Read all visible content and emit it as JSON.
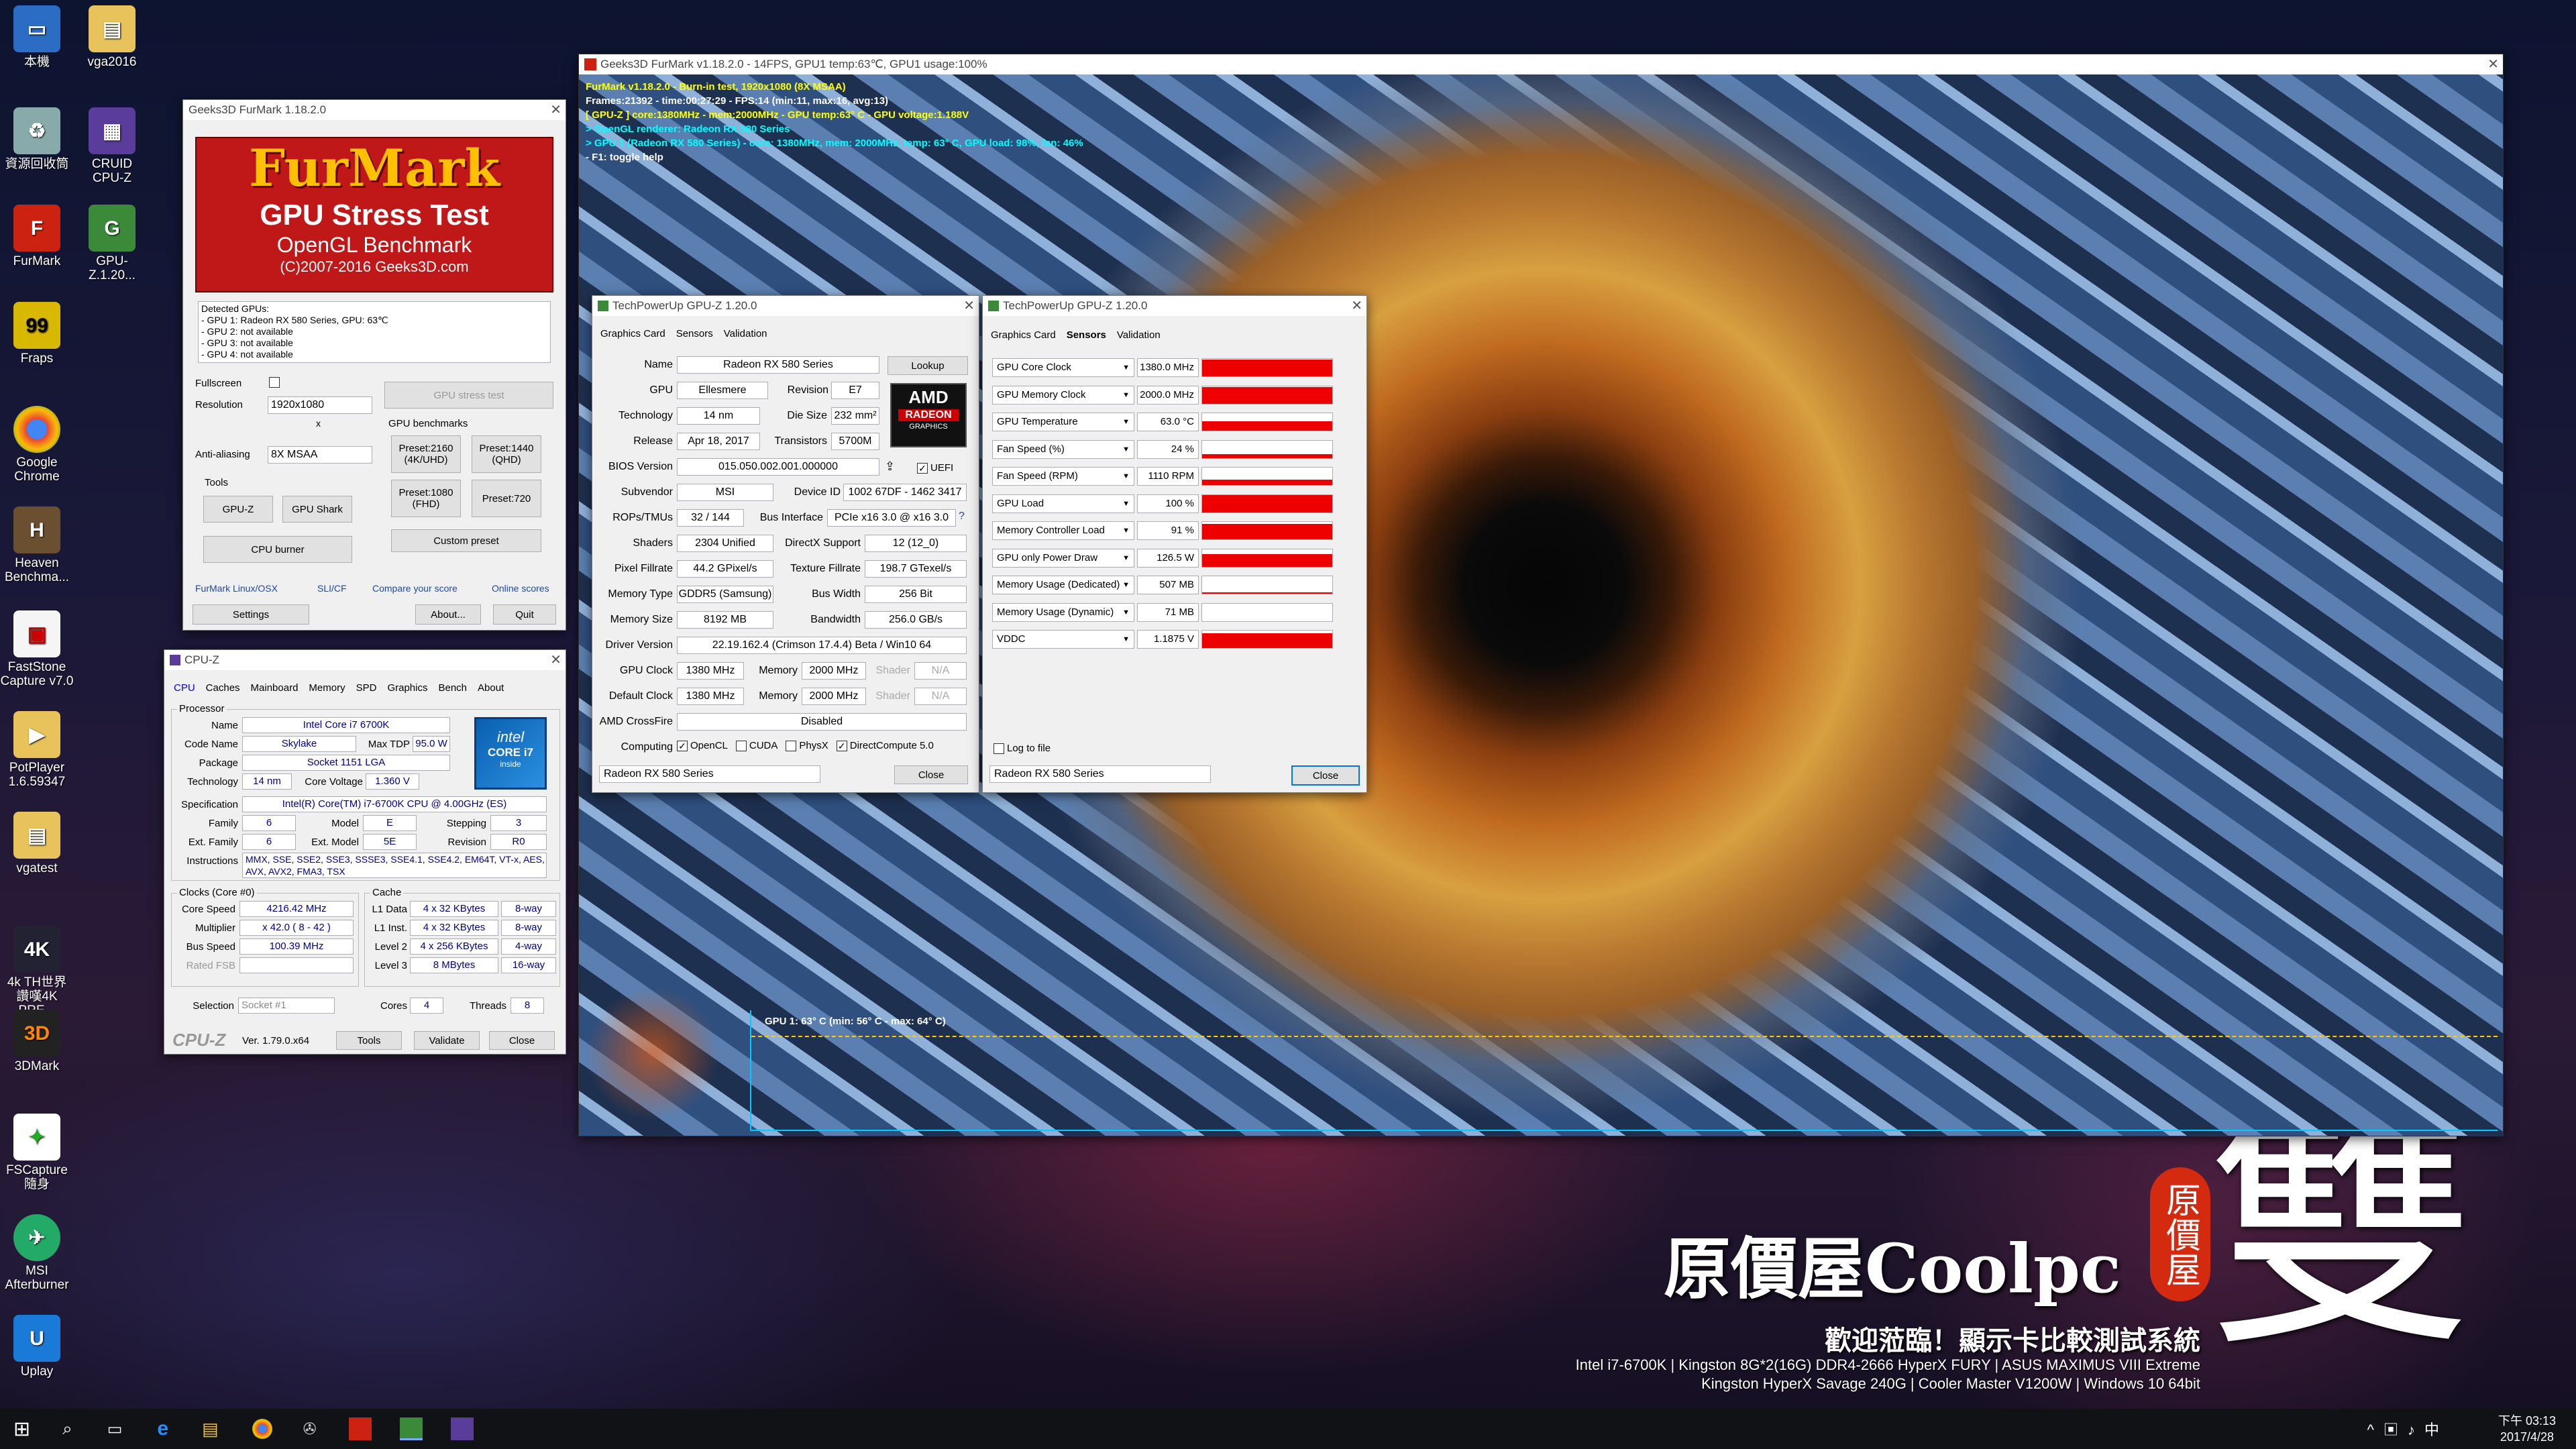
{
  "desktop": {
    "icons": [
      "本機",
      "vga2016",
      "資源回收筒",
      "CRUID CPU-Z",
      "FurMark",
      "GPU-Z.1.20...",
      "Fraps",
      "Google Chrome",
      "Heaven Benchma...",
      "FastStone Capture v7.0",
      "PotPlayer 1.6.59347",
      "vgatest",
      "4k TH世界\n讚嘆4K PRE...",
      "3DMark",
      "FSCapture\n隨身",
      "MSI Afterburner",
      "Uplay"
    ],
    "watermark": {
      "brand": "原價屋Coolpc",
      "seal": "原價屋",
      "char": "雙",
      "welcome": "歡迎蒞臨！顯示卡比較測試系統",
      "spec1": "Intel i7-6700K | Kingston 8G*2(16G) DDR4-2666 HyperX FURY | ASUS MAXIMUS VIII Extreme",
      "spec2": "Kingston HyperX Savage 240G | Cooler Master V1200W | Windows 10 64bit"
    }
  },
  "furmark_main": {
    "title": "Geeks3D FurMark v1.18.2.0 - 14FPS, GPU1 temp:63℃, GPU1 usage:100%",
    "lines": [
      "FurMark v1.18.2.0 - Burn-in test, 1920x1080 (8X MSAA)",
      "Frames:21392 - time:00:27:29 - FPS:14 (min:11, max:16, avg:13)",
      "[ GPU-Z ] core:1380MHz - mem:2000MHz - GPU temp:63° C - GPU voltage:1.188V",
      "> OpenGL renderer: Radeon RX 580 Series",
      "> GPU 1 (Radeon RX 580 Series) - core: 1380MHz, mem: 2000MHz, temp: 63° C, GPU load: 98%, fan: 46%",
      "- F1: toggle help"
    ],
    "graph_label": "GPU 1: 63° C (min: 56° C - max: 64° C)"
  },
  "furmark_launcher": {
    "title": "Geeks3D FurMark 1.18.2.0",
    "logo": "FurMark",
    "logo_sub1": "GPU Stress Test",
    "logo_sub2": "OpenGL Benchmark",
    "logo_sub3": "(C)2007-2016 Geeks3D.com",
    "detected": [
      "Detected GPUs:",
      "- GPU 1: Radeon RX 580 Series, GPU: 63℃",
      "- GPU 2: not available",
      "- GPU 3: not available",
      "- GPU 4: not available"
    ],
    "fullscreen": "Fullscreen",
    "resolution_label": "Resolution",
    "resolution": "1920x1080",
    "x": "x",
    "aa_label": "Anti-aliasing",
    "aa": "8X MSAA",
    "stress_btn": "GPU stress test",
    "bench_label": "GPU benchmarks",
    "tools_label": "Tools",
    "btns": {
      "gpuz": "GPU-Z",
      "shark": "GPU Shark",
      "burner": "CPU burner",
      "p2160": "Preset:2160\n(4K/UHD)",
      "p1440": "Preset:1440\n(QHD)",
      "p1080": "Preset:1080\n(FHD)",
      "p720": "Preset:720",
      "custom": "Custom preset",
      "settings": "Settings",
      "about": "About...",
      "quit": "Quit"
    },
    "links": [
      "FurMark Linux/OSX",
      "SLI/CF",
      "Compare your score",
      "Online scores"
    ]
  },
  "cpuz": {
    "title": "CPU-Z",
    "tabs": [
      "CPU",
      "Caches",
      "Mainboard",
      "Memory",
      "SPD",
      "Graphics",
      "Bench",
      "About"
    ],
    "processor": "Processor",
    "name": "Intel Core i7 6700K",
    "codename": "Skylake",
    "tdp": "95.0 W",
    "package": "Socket 1151 LGA",
    "tech": "14 nm",
    "voltage": "1.360 V",
    "spec": "Intel(R) Core(TM) i7-6700K CPU @ 4.00GHz (ES)",
    "family": "6",
    "model": "E",
    "stepping": "3",
    "extfamily": "6",
    "extmodel": "5E",
    "revision": "R0",
    "instr": "MMX, SSE, SSE2, SSE3, SSSE3, SSE4.1, SSE4.2, EM64T, VT-x, AES, AVX, AVX2, FMA3, TSX",
    "clocks": "Clocks (Core #0)",
    "cache": "Cache",
    "corespeed": "4216.42 MHz",
    "mult": "x 42.0 ( 8 - 42 )",
    "bus": "100.39 MHz",
    "ratedfsb": "Rated FSB",
    "l1d": "4 x 32 KBytes",
    "l1dw": "8-way",
    "l1i": "4 x 32 KBytes",
    "l1iw": "8-way",
    "l2": "4 x 256 KBytes",
    "l2w": "4-way",
    "l3": "8 MBytes",
    "l3w": "16-way",
    "selection": "Socket #1",
    "cores": "4",
    "threads": "8",
    "brand": "CPU-Z",
    "ver": "Ver. 1.79.0.x64",
    "tools": "Tools",
    "validate": "Validate",
    "close": "Close",
    "labels": {
      "name": "Name",
      "codename": "Code Name",
      "tdp": "Max TDP",
      "package": "Package",
      "tech": "Technology",
      "voltage": "Core Voltage",
      "spec": "Specification",
      "family": "Family",
      "model": "Model",
      "stepping": "Stepping",
      "extfamily": "Ext. Family",
      "extmodel": "Ext. Model",
      "revision": "Revision",
      "instr": "Instructions",
      "corespeed": "Core Speed",
      "mult": "Multiplier",
      "bus": "Bus Speed",
      "l1d": "L1 Data",
      "l1i": "L1 Inst.",
      "l2": "Level 2",
      "l3": "Level 3",
      "selection": "Selection",
      "cores": "Cores",
      "threads": "Threads"
    },
    "intel": "intel",
    "core": "CORE i7",
    "inside": "inside"
  },
  "gpuz1": {
    "title": "TechPowerUp GPU-Z 1.20.0",
    "tabs": [
      "Graphics Card",
      "Sensors",
      "Validation"
    ],
    "labels": {
      "name": "Name",
      "gpu": "GPU",
      "revision": "Revision",
      "tech": "Technology",
      "die": "Die Size",
      "release": "Release",
      "trans": "Transistors",
      "bios": "BIOS Version",
      "subvendor": "Subvendor",
      "devid": "Device ID",
      "rops": "ROPs/TMUs",
      "busif": "Bus Interface",
      "shaders": "Shaders",
      "dx": "DirectX Support",
      "pixel": "Pixel Fillrate",
      "texture": "Texture Fillrate",
      "memtype": "Memory Type",
      "buswidth": "Bus Width",
      "memsize": "Memory Size",
      "bandwidth": "Bandwidth",
      "driver": "Driver Version",
      "gpuclock": "GPU Clock",
      "memory": "Memory",
      "shader": "Shader",
      "defclock": "Default Clock",
      "crossfire": "AMD CrossFire",
      "computing": "Computing"
    },
    "name": "Radeon RX 580 Series",
    "lookup": "Lookup",
    "gpu": "Ellesmere",
    "revision": "E7",
    "tech": "14 nm",
    "die": "232 mm²",
    "release": "Apr 18, 2017",
    "trans": "5700M",
    "bios": "015.050.002.001.000000",
    "uefi": "UEFI",
    "subvendor": "MSI",
    "devid": "1002 67DF - 1462 3417",
    "rops": "32 / 144",
    "busif": "PCIe x16 3.0 @ x16 3.0",
    "shaders": "2304 Unified",
    "dx": "12 (12_0)",
    "pixel": "44.2 GPixel/s",
    "texture": "198.7 GTexel/s",
    "memtype": "GDDR5 (Samsung)",
    "buswidth": "256 Bit",
    "memsize": "8192 MB",
    "bandwidth": "256.0 GB/s",
    "driver": "22.19.162.4 (Crimson 17.4.4) Beta / Win10 64",
    "gpuclock": "1380 MHz",
    "memclock": "2000 MHz",
    "shaderclock": "N/A",
    "defclock": "1380 MHz",
    "defmem": "2000 MHz",
    "defshader": "N/A",
    "crossfire": "Disabled",
    "compute": [
      "OpenCL",
      "CUDA",
      "PhysX",
      "DirectCompute 5.0"
    ],
    "select": "Radeon RX 580 Series",
    "close": "Close",
    "amd": "AMD",
    "radeon": "RADEON",
    "graphics": "GRAPHICS"
  },
  "gpuz2": {
    "title": "TechPowerUp GPU-Z 1.20.0",
    "tabs": [
      "Graphics Card",
      "Sensors",
      "Validation"
    ],
    "sensors": [
      {
        "name": "GPU Core Clock",
        "value": "1380.0 MHz",
        "fill": 0.95
      },
      {
        "name": "GPU Memory Clock",
        "value": "2000.0 MHz",
        "fill": 0.95
      },
      {
        "name": "GPU Temperature",
        "value": "63.0 °C",
        "fill": 0.55
      },
      {
        "name": "Fan Speed (%)",
        "value": "24 %",
        "fill": 0.2
      },
      {
        "name": "Fan Speed (RPM)",
        "value": "1110 RPM",
        "fill": 0.3
      },
      {
        "name": "GPU Load",
        "value": "100 %",
        "fill": 1.0
      },
      {
        "name": "Memory Controller Load",
        "value": "91 %",
        "fill": 0.9
      },
      {
        "name": "GPU only Power Draw",
        "value": "126.5 W",
        "fill": 0.7
      },
      {
        "name": "Memory Usage (Dedicated)",
        "value": "507 MB",
        "fill": 0.06
      },
      {
        "name": "Memory Usage (Dynamic)",
        "value": "71 MB",
        "fill": 0.0
      },
      {
        "name": "VDDC",
        "value": "1.1875 V",
        "fill": 0.85
      }
    ],
    "log": "Log to file",
    "select": "Radeon RX 580 Series",
    "close": "Close"
  },
  "taskbar": {
    "time": "下午 03:13",
    "date": "2017/4/28"
  }
}
